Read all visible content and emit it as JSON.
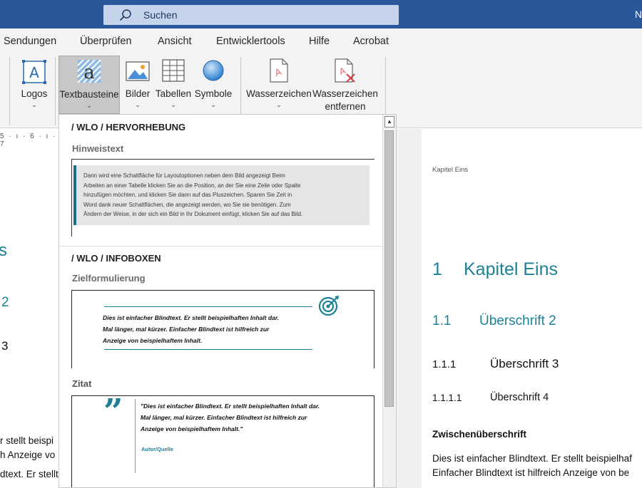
{
  "titlebar": {
    "search_placeholder": "Suchen",
    "corner_initial": "N"
  },
  "tabs": [
    "Sendungen",
    "Überprüfen",
    "Ansicht",
    "Entwicklertools",
    "Hilfe",
    "Acrobat"
  ],
  "ribbon": {
    "logos": "Logos",
    "textbausteine": "Textbausteine",
    "bilder": "Bilder",
    "tabellen": "Tabellen",
    "symbole": "Symbole",
    "wasserzeichen": "Wasserzeichen",
    "wasserzeichen_entfernen_1": "Wasserzeichen",
    "wasserzeichen_entfernen_2": "entfernen"
  },
  "ruler": "5 · ı · 6 · ı · 7",
  "left_page": {
    "frag_s": "s",
    "frag_2": "2",
    "frag_3": "3",
    "line1": "r stellt beispi",
    "line2": "h Anzeige vo",
    "line3": "dtext. Er stellt"
  },
  "right_page": {
    "header": "Kapitel Eins",
    "h1_num": "1",
    "h1_text": "Kapitel Eins",
    "h2_num": "1.1",
    "h2_text": "Überschrift 2",
    "h3_num": "1.1.1",
    "h3_text": "Überschrift 3",
    "h4_num": "1.1.1.1",
    "h4_text": "Überschrift 4",
    "subhead": "Zwischenüberschrift",
    "body1": "Dies ist einfacher Blindtext. Er stellt beispielhaf",
    "body2": "Einfacher Blindtext ist hilfreich Anzeige von be"
  },
  "gallery": {
    "section1": "/ WLO / HERVORHEBUNG",
    "hinweis_title": "Hinweistext",
    "hinweis_lines": [
      "Dann wird eine Schaltfläche für Layoutoptionen neben dem Bild angezeigt Beim",
      "Arbeiten an einer Tabelle klicken Sie an die Position, an der Sie eine Zeile oder Spalte",
      "hinzufügen möchten, und klicken Sie dann auf das Pluszeichen. Sparen Sie Zeit in",
      "Word dank neuer Schaltflächen, die angezeigt werden, wo Sie sie benötigen. Zum",
      "Ändern der Weise, in der sich ein Bild in Ihr Dokument einfügt, klicken Sie auf das Bild."
    ],
    "section2": "/ WLO / INFOBOXEN",
    "ziel_title": "Zielformulierung",
    "ziel_lines": [
      "Dies ist einfacher Blindtext. Er stellt beispielhaften Inhalt dar.",
      "Mal länger, mal kürzer. Einfacher Blindtext ist hilfreich zur",
      "Anzeige von beispielhaftem Inhalt."
    ],
    "zitat_title": "Zitat",
    "zitat_lines": [
      "\"Dies ist einfacher Blindtext. Er stellt beispielhaften Inhalt dar.",
      "Mal länger, mal kürzer. Einfacher Blindtext ist hilfreich zur",
      "Anzeige von beispielhaftem Inhalt.\""
    ],
    "zitat_author": "Autor/Quelle"
  },
  "colors": {
    "titlebar": "#2b579a",
    "accent_teal": "#1d8196"
  }
}
